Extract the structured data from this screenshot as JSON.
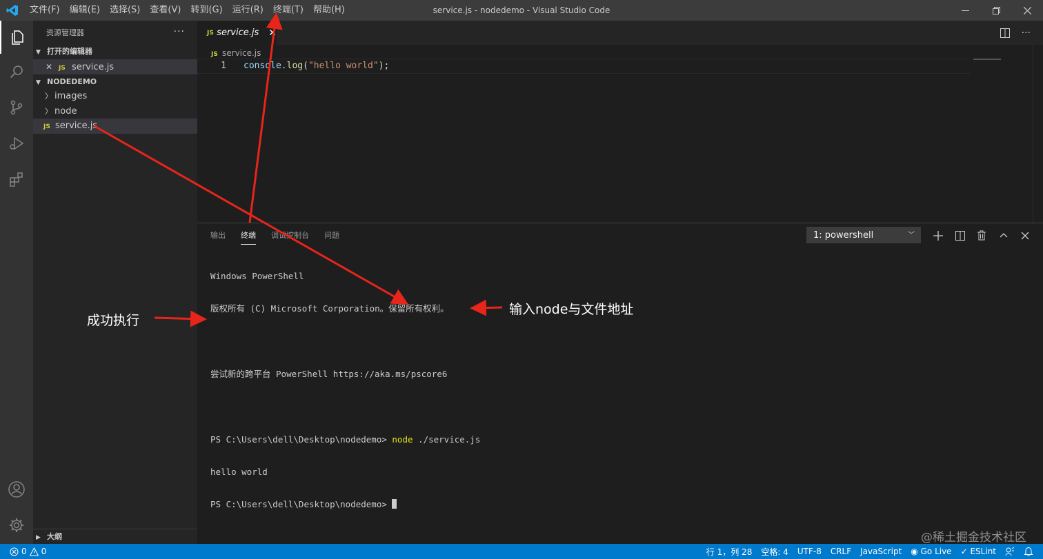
{
  "window": {
    "title": "service.js - nodedemo - Visual Studio Code",
    "menu": [
      "文件(F)",
      "编辑(E)",
      "选择(S)",
      "查看(V)",
      "转到(G)",
      "运行(R)",
      "终端(T)",
      "帮助(H)"
    ]
  },
  "sidebar": {
    "title": "资源管理器",
    "more": "···",
    "open_editors": {
      "label": "打开的编辑器",
      "items": [
        {
          "badge": "JS",
          "name": "service.js",
          "close": "✕"
        }
      ]
    },
    "project": {
      "label": "NODEDEMO",
      "folders": [
        "images",
        "node"
      ],
      "files": [
        {
          "badge": "JS",
          "name": "service.js"
        }
      ]
    },
    "outline_label": "大纲"
  },
  "editor": {
    "tab": {
      "badge": "JS",
      "label": "service.js",
      "close": "✕"
    },
    "breadcrumb": {
      "badge": "JS",
      "label": "service.js"
    },
    "lines": [
      {
        "number": "1",
        "tokens": {
          "obj": "console",
          "dot": ".",
          "fn": "log",
          "open": "(",
          "str": "\"hello world\"",
          "close": ");"
        }
      }
    ]
  },
  "panel": {
    "tabs": [
      "输出",
      "终端",
      "调试控制台",
      "问题"
    ],
    "active_tab": "终端",
    "terminal_select": "1: powershell",
    "terminal": {
      "line1": "Windows PowerShell",
      "line2": "版权所有 (C) Microsoft Corporation。保留所有权利。",
      "line3": "",
      "line4": "尝试新的跨平台 PowerShell https://aka.ms/pscore6",
      "line5": "",
      "line6_prompt": "PS C:\\Users\\dell\\Desktop\\nodedemo> ",
      "line6_cmd": "node",
      "line6_arg": " ./service.js",
      "line7": "hello world",
      "line8_prompt": "PS C:\\Users\\dell\\Desktop\\nodedemo> "
    }
  },
  "statusbar": {
    "errors": "0",
    "warnings": "0",
    "position": "行 1，列 28",
    "spaces": "空格: 4",
    "encoding": "UTF-8",
    "eol": "CRLF",
    "language": "JavaScript",
    "golive": "Go Live",
    "eslint": "ESLint"
  },
  "annotations": {
    "success": "成功执行",
    "input_hint": "输入node与文件地址"
  },
  "watermark": "@稀土掘金技术社区",
  "colors": {
    "activity_bar": "#333333",
    "sidebar": "#252526",
    "editor_bg": "#1e1e1e",
    "status_bar": "#007acc",
    "annotation_arrow": "#e8251a"
  }
}
